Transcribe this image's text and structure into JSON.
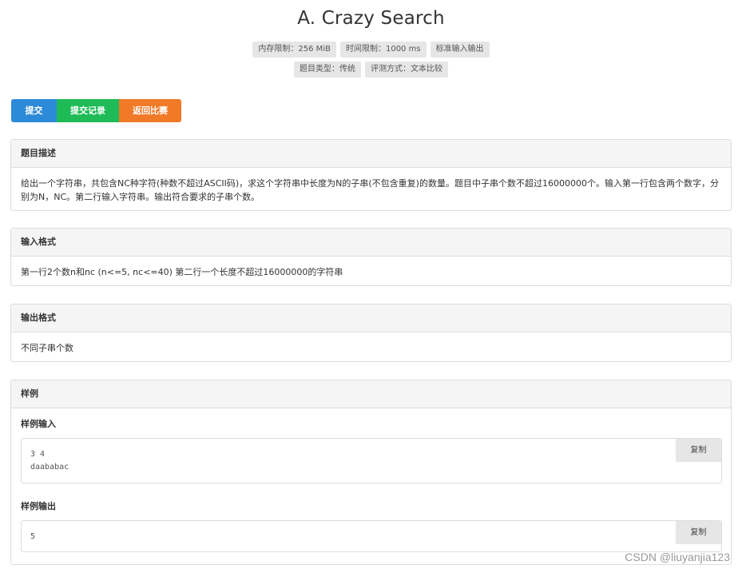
{
  "problem": {
    "title": "A. Crazy Search",
    "meta": {
      "memory": "内存限制：256 MiB",
      "time": "时间限制：1000 ms",
      "io": "标准输入输出",
      "type": "题目类型：传统",
      "judge": "评测方式：文本比较"
    }
  },
  "actions": {
    "submit": "提交",
    "records": "提交记录",
    "back": "返回比赛"
  },
  "sections": {
    "description": {
      "title": "题目描述",
      "text": "给出一个字符串，共包含NC种字符(种数不超过ASCII码)，求这个字符串中长度为N的子串(不包含重复)的数量。题目中子串个数不超过16000000个。输入第一行包含两个数字，分别为N，NC。第二行输入字符串。输出符合要求的子串个数。"
    },
    "input": {
      "title": "输入格式",
      "text": "第一行2个数n和nc (n<=5, nc<=40) 第二行一个长度不超过16000000的字符串"
    },
    "output": {
      "title": "输出格式",
      "text": "不同子串个数"
    },
    "sample": {
      "title": "样例",
      "input_title": "样例输入",
      "input_code": "3 4\ndaababac",
      "output_title": "样例输出",
      "output_code": "5",
      "copy_label": "复制"
    }
  },
  "watermark": "CSDN @liuyanjia123"
}
